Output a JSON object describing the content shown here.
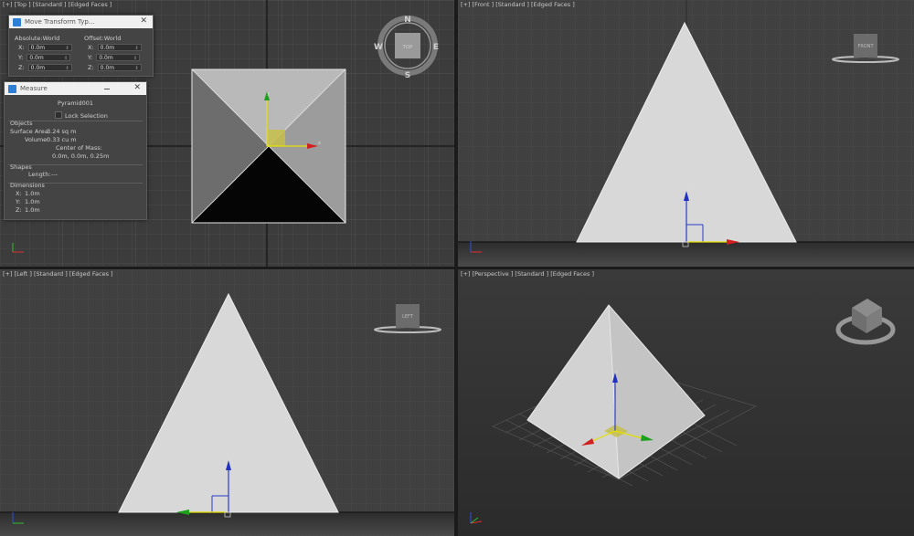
{
  "viewports": {
    "top": {
      "label": "[+] [Top ] [Standard ] [Edged Faces ]",
      "cube": "TOP",
      "compass": {
        "n": "N",
        "s": "S",
        "e": "E",
        "w": "W"
      }
    },
    "front": {
      "label": "[+] [Front ] [Standard ] [Edged Faces ]",
      "cube": "FRONT"
    },
    "left": {
      "label": "[+] [Left ] [Standard ] [Edged Faces ]",
      "cube": "LEFT"
    },
    "perspective": {
      "label": "[+] [Perspective ] [Standard ] [Edged Faces ]"
    }
  },
  "gizmo": {
    "x": "x",
    "y": "y",
    "z": "z"
  },
  "move_dialog": {
    "title": "Move Transform Typ...",
    "absolute_label": "Absolute:World",
    "offset_label": "Offset:World",
    "abs": [
      {
        "axis": "X:",
        "value": "0.0m"
      },
      {
        "axis": "Y:",
        "value": "0.0m"
      },
      {
        "axis": "Z:",
        "value": "0.0m"
      }
    ],
    "off": [
      {
        "axis": "X:",
        "value": "0.0m"
      },
      {
        "axis": "Y:",
        "value": "0.0m"
      },
      {
        "axis": "Z:",
        "value": "0.0m"
      }
    ]
  },
  "measure": {
    "title": "Measure",
    "object_name": "Pyramid001",
    "lock_selection": "Lock Selection",
    "objects_header": "Objects",
    "surface_area_label": "Surface Area:",
    "surface_area_value": "3.24 sq m",
    "volume_label": "Volume:",
    "volume_value": "0.33 cu m",
    "center_of_mass_label": "Center of Mass:",
    "center_of_mass_value": "0.0m, 0.0m, 0.25m",
    "shapes_header": "Shapes",
    "length_label": "Length:",
    "length_value": "---",
    "dimensions_header": "Dimensions",
    "dims": [
      {
        "axis": "X:",
        "value": "1.0m"
      },
      {
        "axis": "Y:",
        "value": "1.0m"
      },
      {
        "axis": "Z:",
        "value": "1.0m"
      }
    ]
  }
}
